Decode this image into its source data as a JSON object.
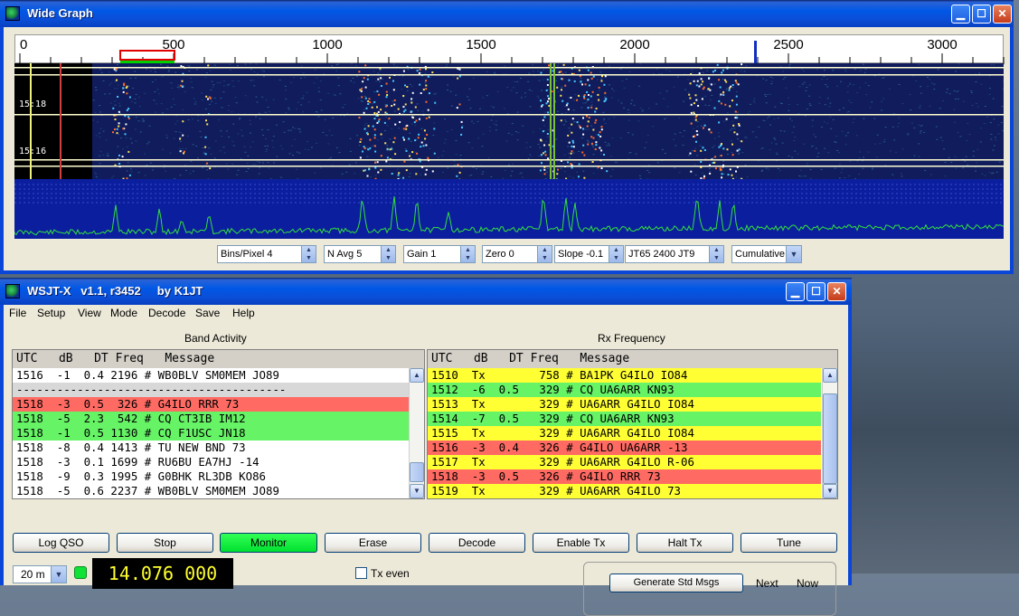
{
  "wide_graph": {
    "title": "Wide Graph",
    "scale_labels": [
      "0",
      "500",
      "1000",
      "1500",
      "2000",
      "2500",
      "3000"
    ],
    "time_labels": [
      "15:18",
      "15:16"
    ],
    "controls": {
      "bins_per_pixel": "Bins/Pixel 4",
      "n_avg": "N Avg 5",
      "gain": "Gain 1",
      "zero": "Zero 0",
      "slope": "Slope -0.1",
      "mode": "JT65  2400  JT9",
      "spectrum_type": "Cumulative"
    }
  },
  "wsjt": {
    "title": "WSJT-X   v1.1, r3452     by K1JT",
    "menu": [
      "File",
      "Setup",
      "View",
      "Mode",
      "Decode",
      "Save",
      "Help"
    ],
    "band_activity": {
      "title": "Band Activity",
      "header": "UTC   dB   DT Freq   Message",
      "rows": [
        {
          "text": "1516  -1  0.4 2196 # WB0BLV SM0MEM JO89",
          "color": "#ffffff"
        },
        {
          "text": "----------------------------------------",
          "color": "#d8d8d8"
        },
        {
          "text": "1518  -3  0.5  326 # G4ILO RRR 73",
          "color": "#ff6a63"
        },
        {
          "text": "1518  -5  2.3  542 # CQ CT3IB IM12",
          "color": "#66f366"
        },
        {
          "text": "1518  -1  0.5 1130 # CQ F1USC JN18",
          "color": "#66f366"
        },
        {
          "text": "1518  -8  0.4 1413 # TU NEW BND 73",
          "color": "#ffffff"
        },
        {
          "text": "1518  -3  0.1 1699 # RU6BU EA7HJ -14",
          "color": "#ffffff"
        },
        {
          "text": "1518  -9  0.3 1995 # G0BHK RL3DB KO86",
          "color": "#ffffff"
        },
        {
          "text": "1518  -5  0.6 2237 # WB0BLV SM0MEM JO89",
          "color": "#ffffff"
        }
      ]
    },
    "rx_frequency": {
      "title": "Rx Frequency",
      "header": "UTC   dB   DT Freq   Message",
      "rows": [
        {
          "text": "1510  Tx        758 # BA1PK G4ILO IO84",
          "color": "#ffff33"
        },
        {
          "text": "1512  -6  0.5   329 # CQ UA6ARR KN93",
          "color": "#66f366"
        },
        {
          "text": "1513  Tx        329 # UA6ARR G4ILO IO84",
          "color": "#ffff33"
        },
        {
          "text": "1514  -7  0.5   329 # CQ UA6ARR KN93",
          "color": "#66f366"
        },
        {
          "text": "1515  Tx        329 # UA6ARR G4ILO IO84",
          "color": "#ffff33"
        },
        {
          "text": "1516  -3  0.4   326 # G4ILO UA6ARR -13",
          "color": "#ff6a63"
        },
        {
          "text": "1517  Tx        329 # UA6ARR G4ILO R-06",
          "color": "#ffff33"
        },
        {
          "text": "1518  -3  0.5   326 # G4ILO RRR 73",
          "color": "#ff6a63"
        },
        {
          "text": "1519  Tx        329 # UA6ARR G4ILO 73",
          "color": "#ffff33"
        }
      ]
    },
    "buttons": [
      "Log QSO",
      "Stop",
      "Monitor",
      "Erase",
      "Decode",
      "Enable Tx",
      "Halt Tx",
      "Tune"
    ],
    "active_button": "Monitor",
    "band": "20 m",
    "frequency": "14.076 000",
    "tx_even_label": "Tx even",
    "generate_label": "Generate Std Msgs",
    "next_label": "Next",
    "now_label": "Now"
  }
}
